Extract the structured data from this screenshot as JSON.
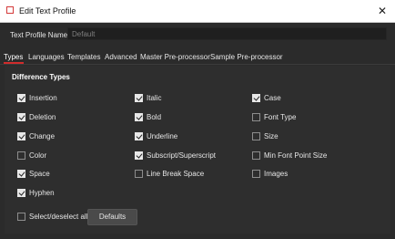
{
  "window": {
    "title": "Edit Text Profile"
  },
  "profile": {
    "label": "Text Profile Name",
    "placeholder": "Default"
  },
  "tabs": [
    {
      "label": "Types",
      "active": true
    },
    {
      "label": "Languages"
    },
    {
      "label": "Templates"
    },
    {
      "label": "Advanced"
    },
    {
      "label": "Master Pre-processor"
    },
    {
      "label": "Sample Pre-processor"
    }
  ],
  "section": {
    "title": "Difference Types"
  },
  "col1": [
    {
      "label": "Insertion",
      "checked": true
    },
    {
      "label": "Deletion",
      "checked": true
    },
    {
      "label": "Change",
      "checked": true
    },
    {
      "label": "Color",
      "checked": false
    },
    {
      "label": "Space",
      "checked": true
    },
    {
      "label": "Hyphen",
      "checked": true
    }
  ],
  "col2": [
    {
      "label": "Italic",
      "checked": true
    },
    {
      "label": "Bold",
      "checked": true
    },
    {
      "label": "Underline",
      "checked": true
    },
    {
      "label": "Subscript/Superscript",
      "checked": true
    },
    {
      "label": "Line Break Space",
      "checked": false
    }
  ],
  "col3": [
    {
      "label": "Case",
      "checked": true
    },
    {
      "label": "Font Type",
      "checked": false
    },
    {
      "label": "Size",
      "checked": false
    },
    {
      "label": "Min Font Point Size",
      "checked": false
    },
    {
      "label": "Images",
      "checked": false
    }
  ],
  "footer": {
    "select_all": {
      "label": "Select/deselect all",
      "checked": false
    },
    "defaults_label": "Defaults"
  },
  "colors": {
    "accent": "#d02c2c",
    "background": "#2b2b2b",
    "titlebar": "#ffffff"
  }
}
